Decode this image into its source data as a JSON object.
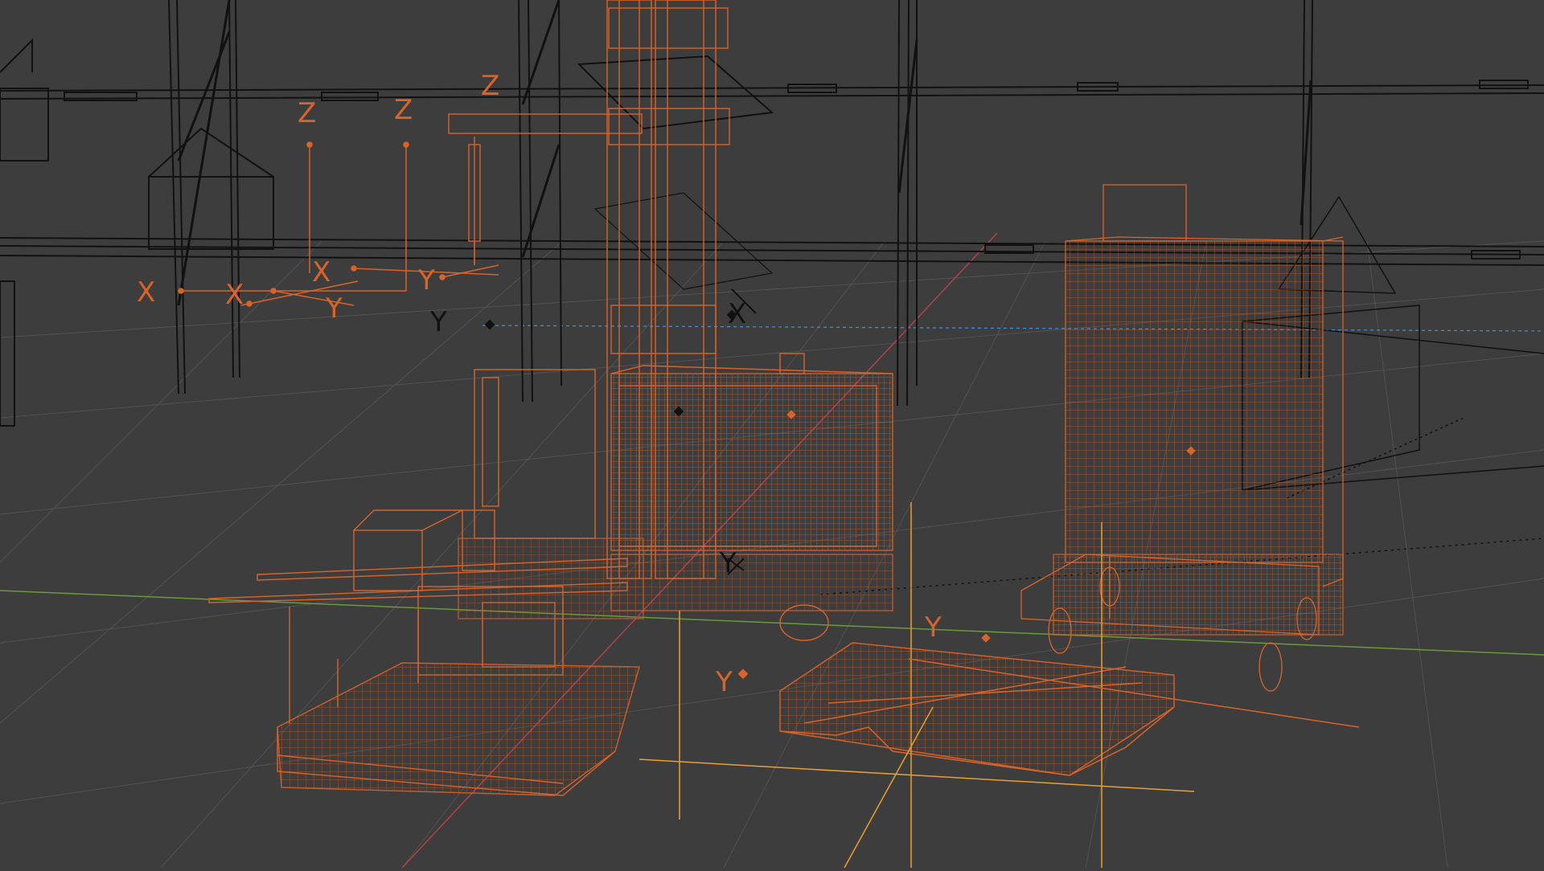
{
  "viewport": {
    "mode": "wireframe",
    "colors": {
      "background": "#3d3d3d",
      "grid": "#525252",
      "selected_wire": "#d9642a",
      "unselected_wire": "#111111",
      "x_axis": "#b04050",
      "y_axis": "#6a9a3a",
      "helper_blue": "#4a8fd9",
      "cursor": "#e8a030"
    }
  },
  "empties": {
    "axis_labels": {
      "z1": "Z",
      "z2": "Z",
      "z3": "Z",
      "x1": "X",
      "x2": "X",
      "x3": "X",
      "x4": "X",
      "y1": "Y",
      "y2": "Y",
      "y3": "Y",
      "y4": "Y",
      "y5": "Y",
      "y6": "Y"
    }
  },
  "objects": [
    {
      "name_icon": "reach-truck-icon"
    },
    {
      "name_icon": "roll-cage-icon"
    },
    {
      "name_icon": "pallet-icon"
    },
    {
      "name_icon": "shelf-rack-icon"
    },
    {
      "name_icon": "camera-icon"
    }
  ]
}
